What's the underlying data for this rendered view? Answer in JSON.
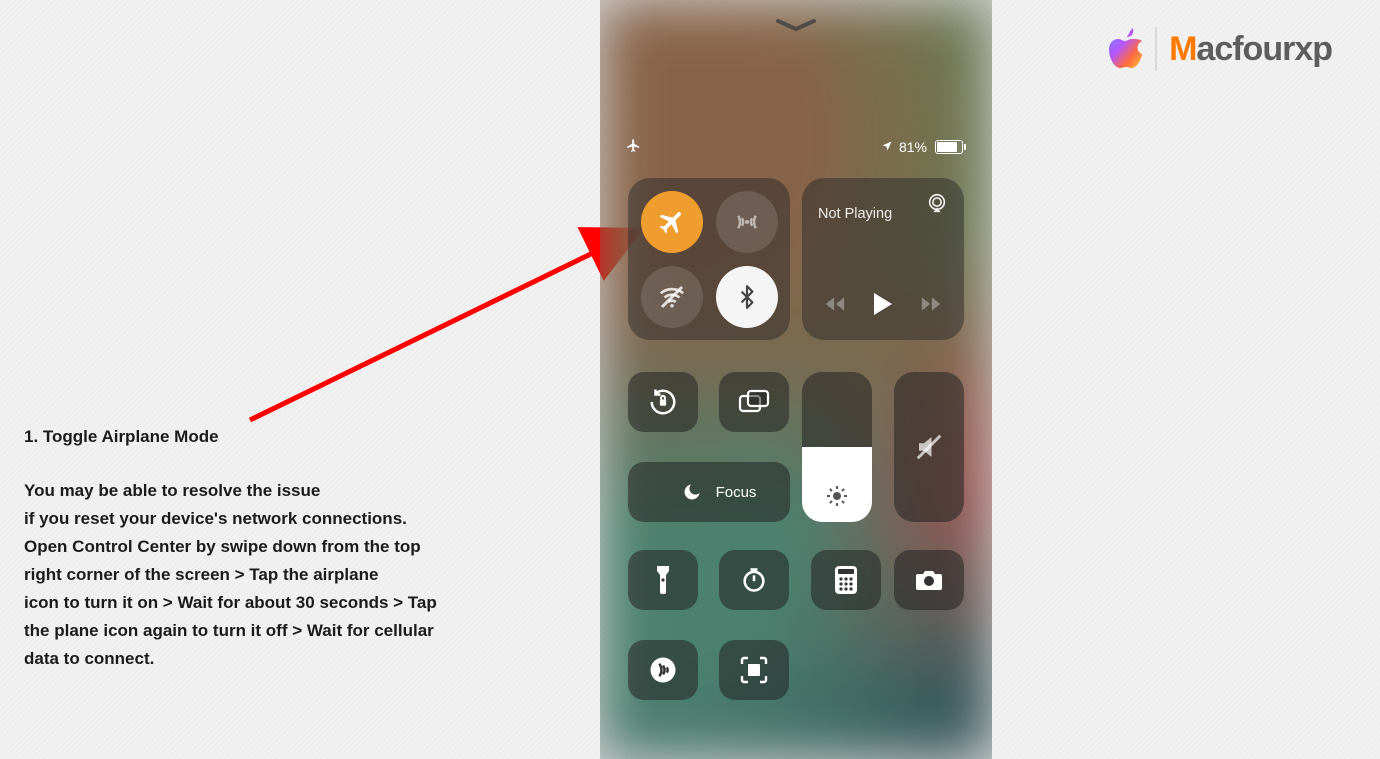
{
  "brand": {
    "name": "Macfourxp"
  },
  "instruction": {
    "heading": "1. Toggle Airplane Mode",
    "body": "You may be able to resolve the issue\nif you reset your device's network connections.\nOpen Control Center by swipe down from the top\nright corner of the screen > Tap the airplane\nicon to turn it on > Wait for about 30 seconds > Tap\nthe plane icon again to turn it off > Wait for cellular\ndata to connect."
  },
  "phone": {
    "status": {
      "battery_pct": "81%"
    },
    "media": {
      "now_playing": "Not Playing"
    },
    "focus": {
      "label": "Focus"
    },
    "brightness_level": 0.5,
    "airplane_on": true,
    "bluetooth_on": true
  }
}
